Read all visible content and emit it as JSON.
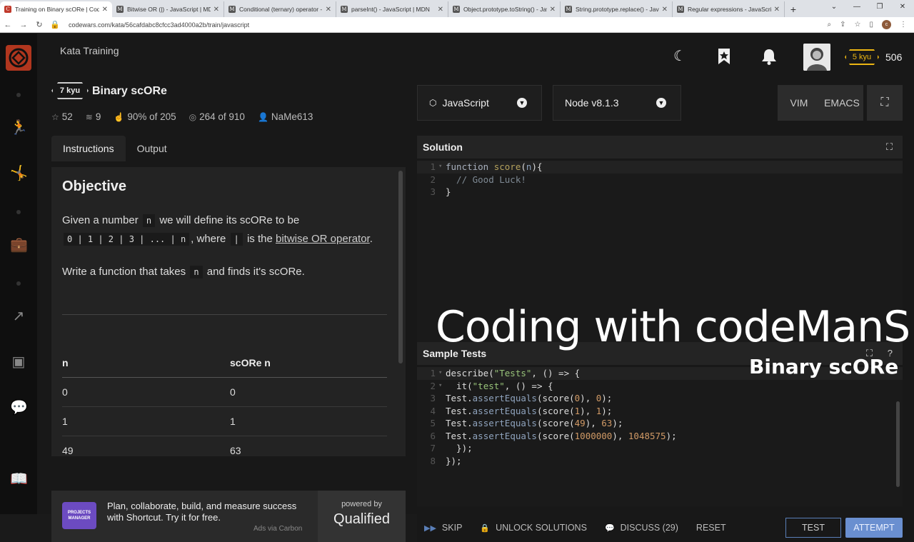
{
  "browser": {
    "tabs": [
      {
        "title": "Training on Binary scORe | Code"
      },
      {
        "title": "Bitwise OR (|) - JavaScript | MDN"
      },
      {
        "title": "Conditional (ternary) operator -"
      },
      {
        "title": "parseInt() - JavaScript | MDN"
      },
      {
        "title": "Object.prototype.toString() - Jav"
      },
      {
        "title": "String.prototype.replace() - Java"
      },
      {
        "title": "Regular expressions - JavaScri"
      }
    ],
    "url": "codewars.com/kata/56cafdabc8cfcc3ad4000a2b/train/javascript"
  },
  "topbar": {
    "section_title": "Kata Training",
    "rank": "5 kyu",
    "honor": "506"
  },
  "kata": {
    "rank": "7 kyu",
    "title": "Binary scORe",
    "stats": {
      "stars": "52",
      "collections": "9",
      "satisfaction": "90% of 205",
      "completed": "264 of 910",
      "author": "NaMe613"
    },
    "tabs": [
      "Instructions",
      "Output"
    ]
  },
  "description": {
    "heading": "Objective",
    "p1_a": "Given a number",
    "p1_code_n": "n",
    "p1_b": "we will define its scORe to be",
    "p1_code_expr": "0 | 1 | 2 | 3 | ... | n",
    "p1_c": ", where",
    "p1_code_pipe": "|",
    "p1_d": "is the",
    "p1_link": "bitwise OR operator",
    "p1_e": ".",
    "p2_a": "Write a function that takes",
    "p2_code": "n",
    "p2_b": "and finds it's scORe.",
    "table": {
      "headers": [
        "n",
        "scORe n"
      ],
      "rows": [
        [
          "0",
          "0"
        ],
        [
          "1",
          "1"
        ],
        [
          "49",
          "63"
        ]
      ]
    }
  },
  "ad": {
    "logo_text": "PROJECTS MANAGER",
    "text": "Plan, collaborate, build, and measure success with Shortcut. Try it for free.",
    "via": "Ads via Carbon",
    "powered_by": "powered by",
    "brand": "Qualified"
  },
  "editor": {
    "language": "JavaScript",
    "version": "Node v8.1.3",
    "modes": [
      "VIM",
      "EMACS"
    ],
    "solution_title": "Solution",
    "tests_title": "Sample Tests"
  },
  "overlay": {
    "title": "Coding with codeManS",
    "subtitle": "Binary scORe"
  },
  "bottom": {
    "skip": "SKIP",
    "unlock": "UNLOCK SOLUTIONS",
    "discuss": "DISCUSS (29)",
    "reset": "RESET",
    "test": "TEST",
    "attempt": "ATTEMPT"
  },
  "icons": {
    "logo": "codewars-logo",
    "theme": "moon-icon",
    "bookmark": "bookmark-star-icon",
    "notifications": "bell-icon"
  },
  "colors": {
    "brand": "#b1361e",
    "rank_yellow": "#ecb613",
    "attempt_blue": "#6a8fd0"
  }
}
